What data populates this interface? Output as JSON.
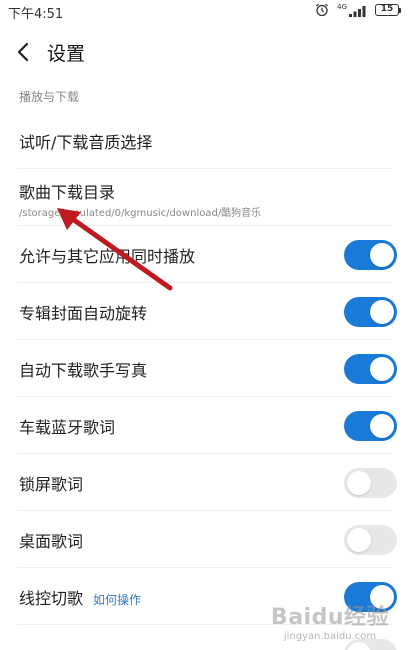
{
  "status_bar": {
    "time": "下午4:51",
    "network_label": "4G",
    "battery_level": "15",
    "icons": [
      "alarm-icon",
      "signal-icon",
      "battery-icon"
    ]
  },
  "header": {
    "title": "设置",
    "back_icon": "chevron-left-icon"
  },
  "section": {
    "label": "播放与下载"
  },
  "rows": [
    {
      "label": "试听/下载音质选择"
    },
    {
      "label": "歌曲下载目录",
      "sub": "/storage/emulated/0/kgmusic/download/酷狗音乐"
    },
    {
      "label": "允许与其它应用同时播放",
      "toggle_on": true
    },
    {
      "label": "专辑封面自动旋转",
      "toggle_on": true
    },
    {
      "label": "自动下载歌手写真",
      "toggle_on": true
    },
    {
      "label": "车载蓝牙歌词",
      "toggle_on": true
    },
    {
      "label": "锁屏歌词",
      "toggle_on": false
    },
    {
      "label": "桌面歌词",
      "toggle_on": false
    },
    {
      "label": "线控切歌",
      "link": "如何操作",
      "toggle_on": true
    },
    {
      "label": "",
      "toggle_on": false
    }
  ],
  "colors": {
    "toggle_on": "#1a7ad8",
    "toggle_off": "#e7e7e7",
    "link": "#3479c9",
    "annotation_arrow": "#c0191f"
  },
  "watermark": {
    "main": "Baidu经验",
    "sub": "jingyan.baidu.com"
  }
}
